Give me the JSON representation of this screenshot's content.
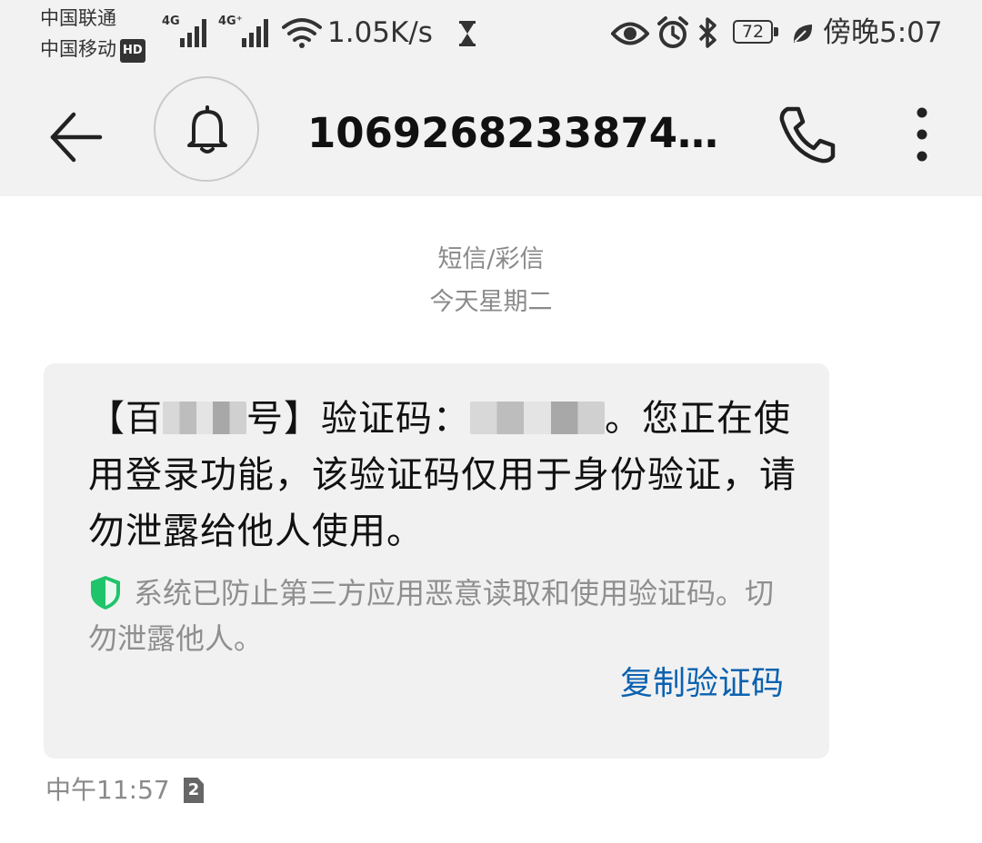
{
  "status_bar": {
    "carrier_1": "中国联通",
    "carrier_2": "中国移动",
    "hd_badge": "HD",
    "network_1": "4G",
    "network_2": "4G⁺",
    "net_speed": "1.05K/s",
    "battery": "72",
    "time": "傍晚5:07",
    "icons": [
      "signal-icon",
      "wifi-icon",
      "hourglass-icon",
      "eye-icon",
      "alarm-icon",
      "bluetooth-icon",
      "battery-icon",
      "leaf-icon"
    ]
  },
  "header": {
    "title": "10692682338743...",
    "icons": [
      "back-arrow-icon",
      "bell-icon",
      "phone-icon",
      "more-vertical-icon"
    ]
  },
  "conversation": {
    "message_type": "短信/彩信",
    "date_label": "今天星期二",
    "message": {
      "text_part1": "【百",
      "text_part2": "号】验证码：",
      "text_part3": "。您正在使用登录功能，该验证码仅用于身份验证，请勿泄露给他人使用。",
      "security_note": "系统已防止第三方应用恶意读取和使用验证码。切勿泄露他人。",
      "copy_action": "复制验证码",
      "time": "中午11:57",
      "sim_slot": "2"
    }
  },
  "colors": {
    "background": "#ffffff",
    "header_bg": "#f2f2f2",
    "bubble_bg": "#f1f1f1",
    "link": "#0b62b0",
    "shield": "#1fc46a",
    "muted_text": "#8a8a8a"
  }
}
